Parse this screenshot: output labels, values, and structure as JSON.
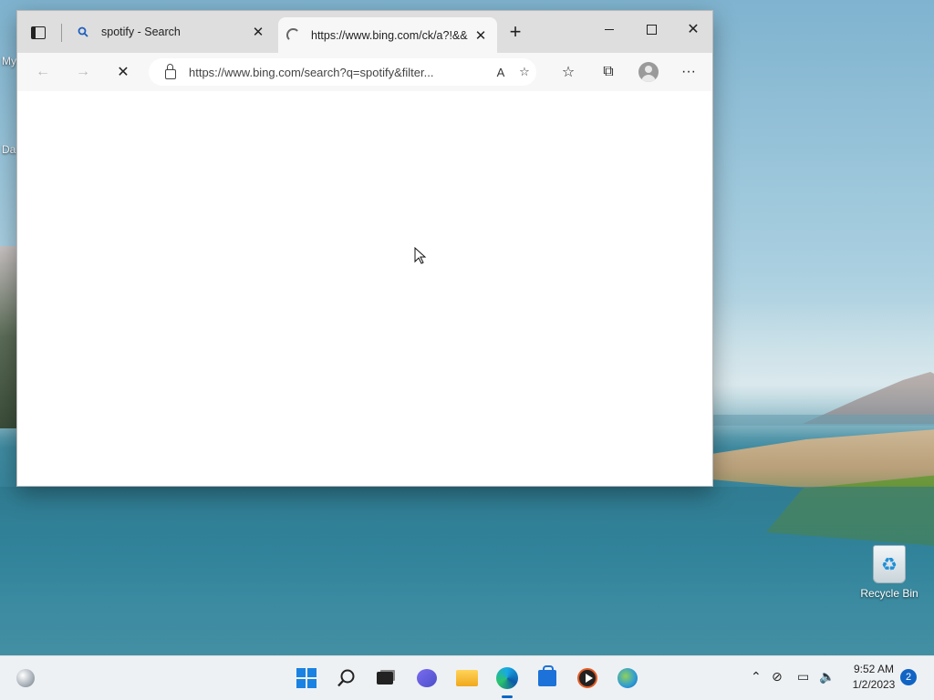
{
  "desktop": {
    "recycle_bin_label": "Recycle Bin",
    "partial_icon_label_1": "My",
    "partial_icon_label_2": "Da"
  },
  "browser": {
    "tabs": [
      {
        "title": "spotify - Search",
        "icon": "search-icon",
        "close": "✕"
      },
      {
        "title": "https://www.bing.com/ck/a?!&&",
        "icon": "loading-spinner-icon",
        "close": "✕"
      }
    ],
    "new_tab": "+",
    "window_controls": {
      "close": "✕"
    },
    "toolbar": {
      "back": "←",
      "forward": "→",
      "stop": "✕",
      "address_url": "https://www.bing.com/search?q=spotify&filter...",
      "read_aloud": "A",
      "add_favorite": "☆",
      "favorites": "☆",
      "collections": "⧉",
      "more": "···"
    }
  },
  "taskbar": {
    "search_glyph": "⌕",
    "tray": {
      "chevron": "⌃",
      "network_off": "⊘",
      "network": "▭",
      "volume": "🔈"
    },
    "clock": {
      "time": "9:52 AM",
      "date": "1/2/2023"
    },
    "notifications": "2"
  },
  "colors": {
    "accent": "#0a67c7",
    "start_blue": "#1a82e2",
    "titlebar": "#dedede"
  }
}
